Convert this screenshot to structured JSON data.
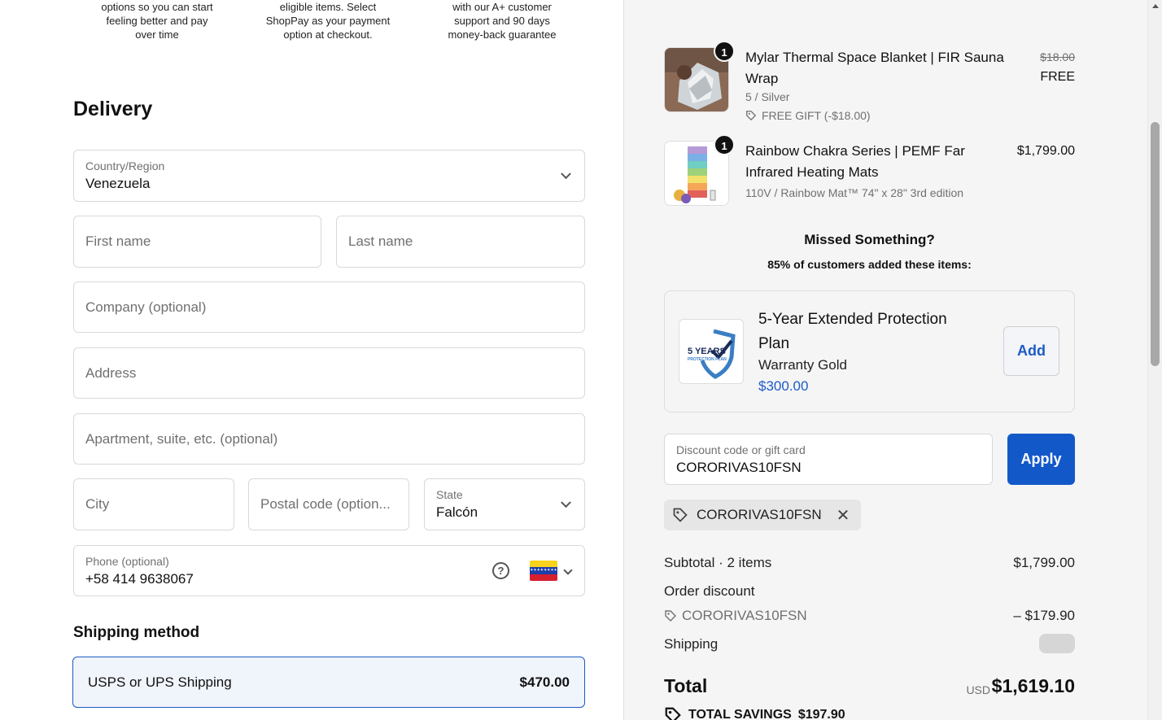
{
  "perks": [
    {
      "lines": [
        "options so you can start",
        "feeling better and pay",
        "over time"
      ]
    },
    {
      "lines": [
        "eligible items. Select",
        "ShopPay as your payment",
        "option at checkout."
      ]
    },
    {
      "lines": [
        "with our A+ customer",
        "support and 90 days",
        "money-back guarantee"
      ]
    }
  ],
  "delivery": {
    "heading": "Delivery",
    "country": {
      "label": "Country/Region",
      "value": "Venezuela"
    },
    "first_name": {
      "placeholder": "First name"
    },
    "last_name": {
      "placeholder": "Last name"
    },
    "company": {
      "placeholder": "Company (optional)"
    },
    "address": {
      "placeholder": "Address"
    },
    "apartment": {
      "placeholder": "Apartment, suite, etc. (optional)"
    },
    "city": {
      "placeholder": "City"
    },
    "postal": {
      "placeholder": "Postal code (option..."
    },
    "state": {
      "label": "State",
      "value": "Falcón"
    },
    "phone": {
      "label": "Phone (optional)",
      "value": "+58 414 9638067",
      "help": "?"
    }
  },
  "shipping": {
    "heading": "Shipping method",
    "option_name": "USPS or UPS Shipping",
    "option_price": "$470.00"
  },
  "items": [
    {
      "qty": "1",
      "title": "Mylar Thermal Space Blanket | FIR Sauna Wrap",
      "variant": "5 / Silver",
      "gift": "FREE GIFT (-$18.00)",
      "original_price": "$18.00",
      "price": "FREE"
    },
    {
      "qty": "1",
      "title": "Rainbow Chakra Series | PEMF Far Infrared Heating Mats",
      "variant": "110V / Rainbow Mat™ 74\" x 28\" 3rd edition",
      "price": "$1,799.00"
    }
  ],
  "missed": {
    "heading": "Missed Something?",
    "subheading": "85% of customers added these items:"
  },
  "upsell": {
    "logo_text": "5 YEARS",
    "logo_sub": "PROTECTION PLAN",
    "title": "5-Year Extended Protection Plan",
    "subtitle": "Warranty Gold",
    "price": "$300.00",
    "add_label": "Add"
  },
  "discount": {
    "label": "Discount code or gift card",
    "value": "CORORIVAS10FSN",
    "apply_label": "Apply",
    "applied_code": "CORORIVAS10FSN"
  },
  "summary": {
    "subtotal_label": "Subtotal · 2 items",
    "subtotal_value": "$1,799.00",
    "order_discount_label": "Order discount",
    "discount_code": "CORORIVAS10FSN",
    "discount_value": "– $179.90",
    "shipping_label": "Shipping",
    "total_label": "Total",
    "currency": "USD",
    "total_value": "$1,619.10",
    "savings_label": "TOTAL SAVINGS",
    "savings_value": "$197.90"
  },
  "colors": {
    "accent": "#1358c8",
    "selected_bg": "#f0f4fb",
    "sidebar_bg": "#f5f5f5"
  }
}
